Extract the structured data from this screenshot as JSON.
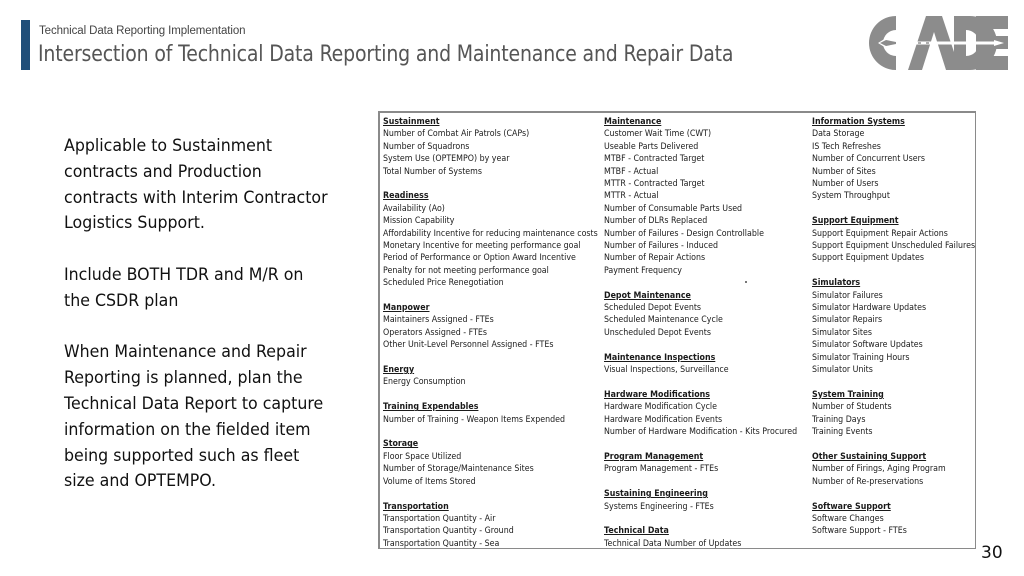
{
  "header": {
    "subtitle": "Technical Data Reporting Implementation",
    "title": "Intersection of Technical Data Reporting and Maintenance and Repair Data",
    "accent_color": "#1f4e79"
  },
  "logo": {
    "text": "CADE",
    "icon": "cade-logo-dart-icon",
    "color": "#8c8c8c"
  },
  "body": {
    "paragraphs": [
      "Applicable to Sustainment contracts and Production contracts with Interim Contractor Logistics Support.",
      "Include BOTH TDR and M/R on the CSDR plan",
      "When Maintenance and Repair Reporting is planned, plan the Technical Data Report to capture information on the fielded item being supported such as fleet size and OPTEMPO."
    ]
  },
  "table": {
    "columns": [
      {
        "groups": [
          {
            "heading": "Sustainment",
            "items": [
              "Number of Combat Air Patrols (CAPs)",
              "Number of Squadrons",
              "System Use (OPTEMPO) by year",
              "Total Number of Systems"
            ]
          },
          {
            "heading": "Readiness",
            "items": [
              "Availability (Ao)",
              "Mission Capability",
              "Affordability Incentive for reducing maintenance costs",
              "Monetary Incentive for meeting performance goal",
              "Period of Performance or Option Award Incentive",
              "Penalty for not meeting performance goal",
              "Scheduled Price Renegotiation"
            ]
          },
          {
            "heading": "Manpower",
            "items": [
              "Maintainers Assigned - FTEs",
              "Operators Assigned - FTEs",
              "Other Unit-Level Personnel Assigned - FTEs"
            ]
          },
          {
            "heading": "Energy",
            "items": [
              "Energy Consumption"
            ]
          },
          {
            "heading": "Training Expendables",
            "items": [
              "Number of Training - Weapon Items Expended"
            ]
          },
          {
            "heading": "Storage",
            "items": [
              "Floor Space Utilized",
              "Number of Storage/Maintenance Sites",
              "Volume of Items Stored"
            ]
          },
          {
            "heading": "Transportation",
            "items": [
              "Transportation Quantity - Air",
              "Transportation Quantity - Ground",
              "Transportation Quantity - Sea"
            ]
          }
        ]
      },
      {
        "groups": [
          {
            "heading": "Maintenance",
            "items": [
              "Customer Wait Time (CWT)",
              "Useable Parts Delivered",
              "MTBF - Contracted Target",
              "MTBF - Actual",
              "MTTR - Contracted Target",
              "MTTR - Actual",
              "Number of Consumable Parts Used",
              "Number of DLRs Replaced",
              "Number of Failures - Design Controllable",
              "Number of Failures - Induced",
              "Number of Repair Actions",
              "Payment Frequency"
            ]
          },
          {
            "heading": "Depot Maintenance",
            "items": [
              "Scheduled Depot Events",
              "Scheduled Maintenance Cycle",
              "Unscheduled Depot Events"
            ]
          },
          {
            "heading": "Maintenance Inspections",
            "items": [
              "Visual Inspections, Surveillance"
            ]
          },
          {
            "heading": "Hardware Modifications",
            "items": [
              "Hardware Modification Cycle",
              "Hardware Modification Events",
              "Number of Hardware Modification - Kits Procured"
            ]
          },
          {
            "heading": "Program Management",
            "items": [
              "Program Management - FTEs"
            ]
          },
          {
            "heading": "Sustaining Engineering",
            "items": [
              "Systems Engineering - FTEs"
            ]
          },
          {
            "heading": "Technical Data",
            "items": [
              "Technical Data Number of Updates"
            ]
          }
        ]
      },
      {
        "groups": [
          {
            "heading": "Information Systems",
            "items": [
              "Data Storage",
              "IS Tech Refreshes",
              "Number of Concurrent Users",
              "Number of Sites",
              "Number of Users",
              "System Throughput"
            ]
          },
          {
            "heading": "Support Equipment",
            "items": [
              "Support Equipment Repair Actions",
              "Support Equipment Unscheduled Failures",
              "Support Equipment Updates"
            ]
          },
          {
            "heading": "Simulators",
            "items": [
              "Simulator Failures",
              "Simulator Hardware Updates",
              "Simulator Repairs",
              "Simulator Sites",
              "Simulator Software Updates",
              "Simulator Training Hours",
              "Simulator Units"
            ]
          },
          {
            "heading": "System Training",
            "items": [
              "Number of Students",
              "Training Days",
              "Training Events"
            ]
          },
          {
            "heading": "Other Sustaining Support",
            "items": [
              "Number of Firings, Aging Program",
              "Number of Re-preservations"
            ]
          },
          {
            "heading": "Software Support",
            "items": [
              "Software Changes",
              "Software Support - FTEs"
            ]
          }
        ]
      }
    ]
  },
  "footer": {
    "page_number": "30"
  }
}
